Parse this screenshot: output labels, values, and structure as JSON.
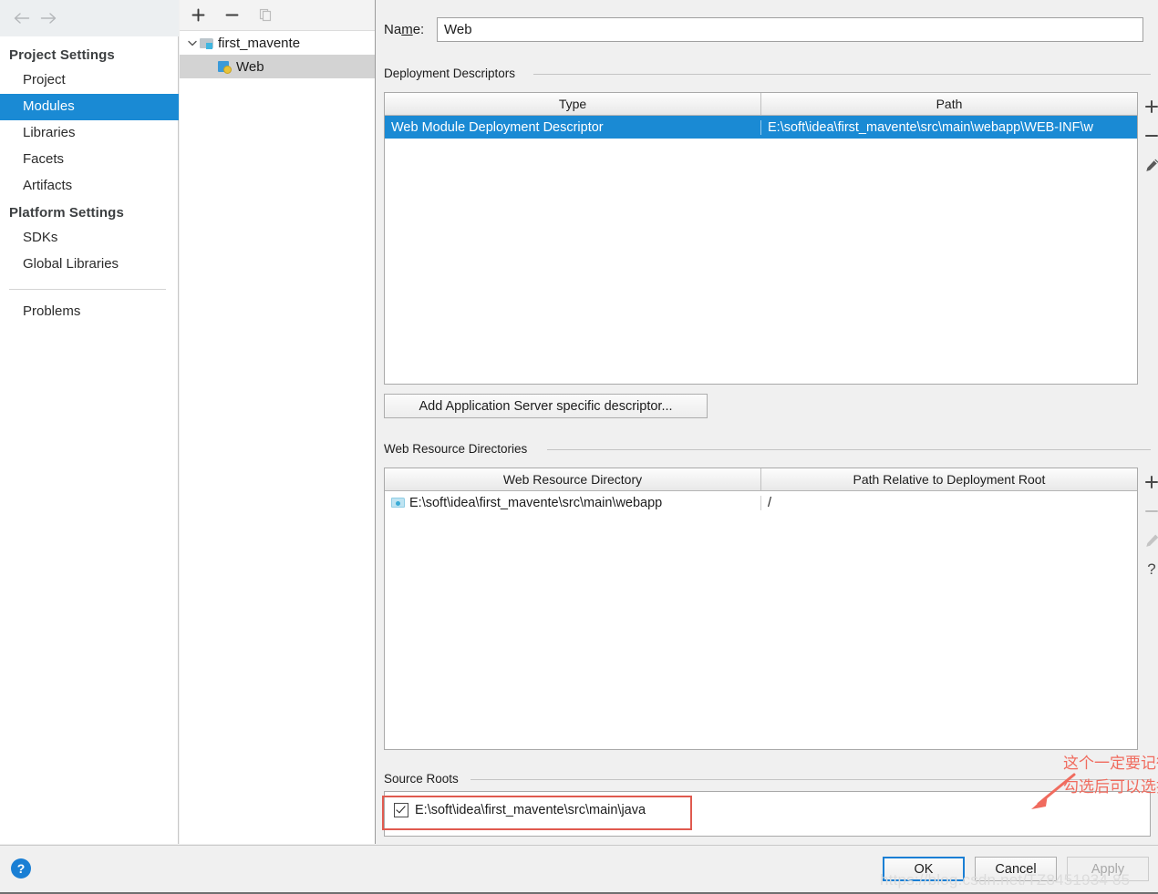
{
  "nav": {
    "back_icon": "arrow-left-icon",
    "forward_icon": "arrow-right-icon"
  },
  "sidebar": {
    "groups": [
      {
        "title": "Project Settings",
        "items": [
          {
            "label": "Project",
            "selected": false
          },
          {
            "label": "Modules",
            "selected": true
          },
          {
            "label": "Libraries",
            "selected": false
          },
          {
            "label": "Facets",
            "selected": false
          },
          {
            "label": "Artifacts",
            "selected": false
          }
        ]
      },
      {
        "title": "Platform Settings",
        "items": [
          {
            "label": "SDKs",
            "selected": false
          },
          {
            "label": "Global Libraries",
            "selected": false
          }
        ]
      }
    ],
    "problems_label": "Problems",
    "selection_color": "#1a8ad4"
  },
  "tree": {
    "toolbar": [
      {
        "name": "add-module-button",
        "glyph": "+"
      },
      {
        "name": "remove-module-button",
        "glyph": "−"
      },
      {
        "name": "copy-module-button",
        "glyph": "❐"
      }
    ],
    "nodes": [
      {
        "label": "first_mavente",
        "icon": "project-folder-icon",
        "expanded": true,
        "selected": false
      },
      {
        "label": "Web",
        "icon": "web-facet-icon",
        "expanded": false,
        "selected": true
      }
    ],
    "chevron_glyph": "⌄"
  },
  "main": {
    "name_label": "Name:",
    "name_label_pre": "Na",
    "name_label_underlined": "m",
    "name_label_post": "e:",
    "name_value": "Web",
    "deployment": {
      "title": "Deployment Descriptors",
      "columns": [
        "Type",
        "Path"
      ],
      "rows": [
        {
          "type": "Web Module Deployment Descriptor",
          "path": "E:\\soft\\idea\\first_mavente\\src\\main\\webapp\\WEB-INF\\w",
          "selected": true
        }
      ],
      "side_buttons": [
        {
          "name": "add-descriptor-icon",
          "glyph": "+",
          "enabled": true
        },
        {
          "name": "remove-descriptor-icon",
          "glyph": "−",
          "enabled": true
        },
        {
          "name": "edit-descriptor-icon",
          "glyph": "✎",
          "enabled": true
        }
      ]
    },
    "add_descriptor_button": "Add Application Server specific descriptor...",
    "web_resources": {
      "title": "Web Resource Directories",
      "columns": [
        "Web Resource Directory",
        "Path Relative to Deployment Root"
      ],
      "rows": [
        {
          "directory": "E:\\soft\\idea\\first_mavente\\src\\main\\webapp",
          "relative_path": "/",
          "icon": "folder-icon"
        }
      ],
      "side_buttons": [
        {
          "name": "add-resource-icon",
          "glyph": "+",
          "enabled": true
        },
        {
          "name": "remove-resource-icon",
          "glyph": "−",
          "enabled": false
        },
        {
          "name": "edit-resource-icon",
          "glyph": "✎",
          "enabled": false
        },
        {
          "name": "help-resource-icon",
          "glyph": "?",
          "enabled": true
        }
      ]
    },
    "source_roots": {
      "title": "Source Roots",
      "items": [
        {
          "label": "E:\\soft\\idea\\first_mavente\\src\\main\\java",
          "checked": true
        }
      ]
    }
  },
  "annotation": {
    "line1": "这个一定要记得勾选，",
    "line2": "勾选后可以选择servlet等",
    "color": "#f06b5e",
    "highlight_color": "#e05a4f"
  },
  "bottom": {
    "help_glyph": "?",
    "ok_label": "OK",
    "cancel_label": "Cancel",
    "apply_label": "Apply",
    "watermark": "https://blog.csdn.net/TZ8451934 85"
  }
}
